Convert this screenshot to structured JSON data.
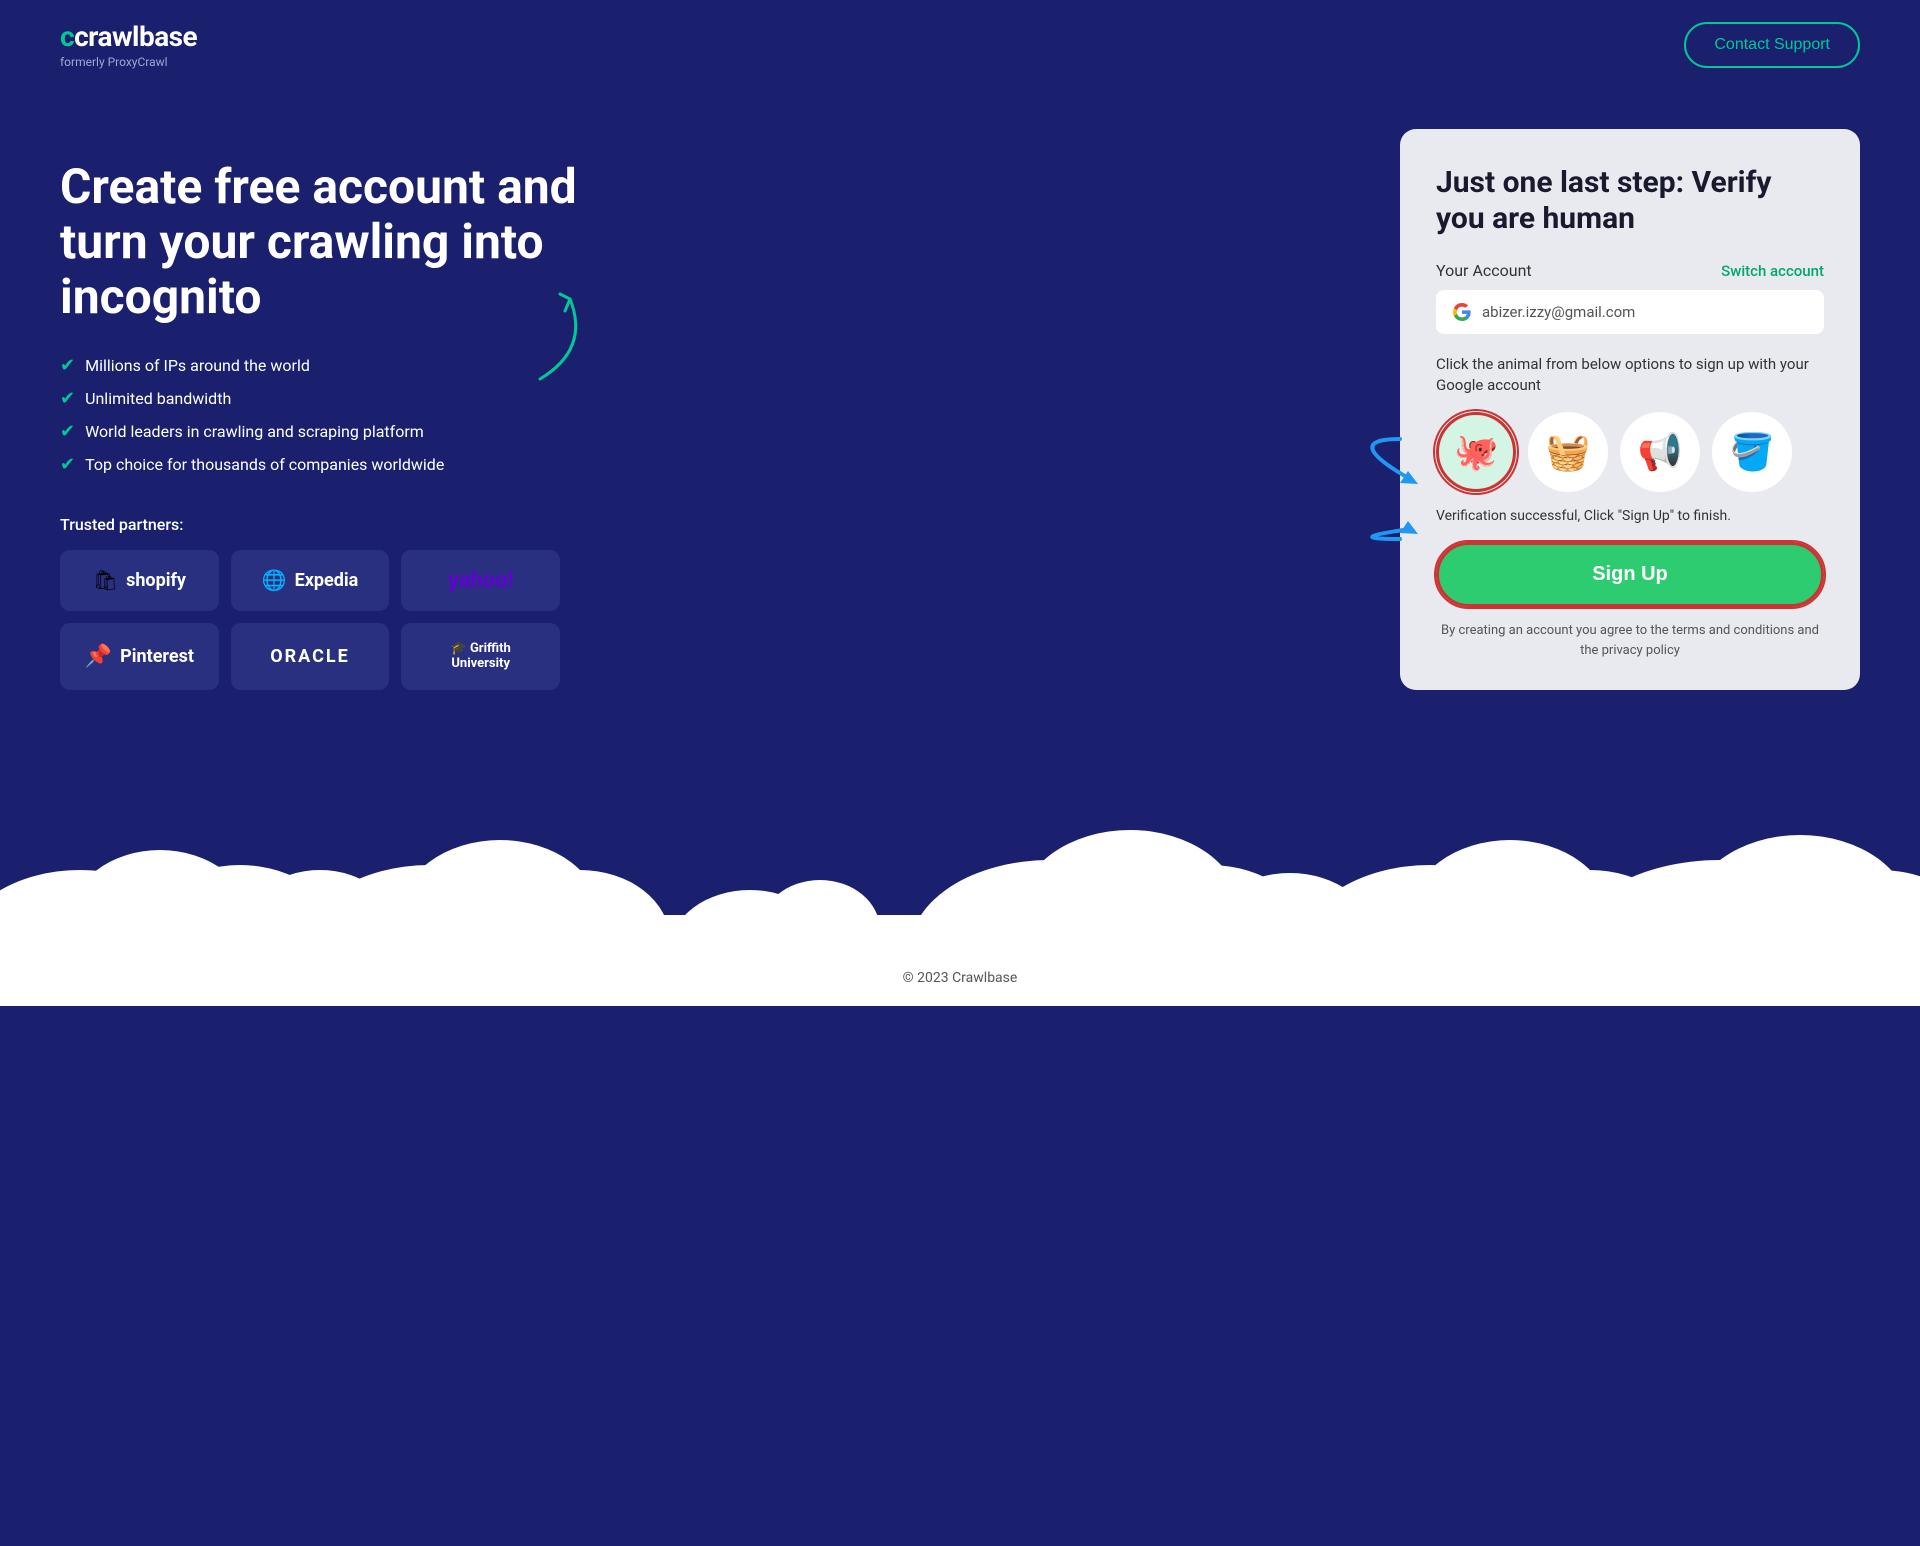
{
  "header": {
    "logo_text": "crawlbase",
    "logo_subtitle": "formerly ProxyCrawl",
    "contact_btn": "Contact Support"
  },
  "hero": {
    "title": "Create free account and turn your crawling into incognito",
    "features": [
      "Millions of IPs around the world",
      "Unlimited bandwidth",
      "World leaders in crawling and scraping platform",
      "Top choice for thousands of companies worldwide"
    ],
    "trusted_label": "Trusted partners:"
  },
  "partners": [
    {
      "name": "shopify",
      "icon": "🛍"
    },
    {
      "name": "Expedia",
      "icon": "🌐"
    },
    {
      "name": "yahoo!",
      "icon": ""
    },
    {
      "name": "Pinterest",
      "icon": "📌"
    },
    {
      "name": "ORACLE",
      "icon": ""
    },
    {
      "name": "Griffith University",
      "icon": "🎓"
    }
  ],
  "card": {
    "title": "Just one last step: Verify you are human",
    "account_label": "Your Account",
    "switch_account": "Switch account",
    "email": "abizer.izzy@gmail.com",
    "instruction": "Click the animal from below options to sign up with your Google account",
    "animals": [
      "🐙",
      "🧺",
      "📢",
      "🪣"
    ],
    "selected_index": 0,
    "verification_msg": "Verification successful, Click \"Sign Up\" to finish.",
    "signup_btn": "Sign Up",
    "terms_text": "By creating an account you agree to the terms and conditions and the privacy policy"
  },
  "footer": {
    "copyright": "© 2023 Crawlbase"
  }
}
